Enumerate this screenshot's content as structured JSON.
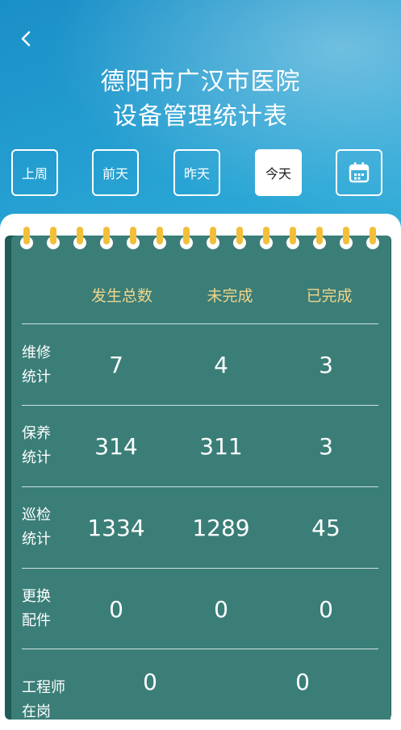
{
  "header": {
    "back_icon": "chevron-left-icon",
    "title_line1": "德阳市广汉市医院",
    "title_line2": "设备管理统计表"
  },
  "date_tabs": [
    {
      "label": "上周",
      "active": false
    },
    {
      "label": "前天",
      "active": false
    },
    {
      "label": "昨天",
      "active": false
    },
    {
      "label": "今天",
      "active": true
    }
  ],
  "calendar_icon": "calendar-icon",
  "colors": {
    "accent_gold": "#f1d58a",
    "card_teal": "#3b7e78",
    "ring_yellow": "#f2bf3b"
  },
  "table": {
    "columns": [
      "发生总数",
      "未完成",
      "已完成"
    ],
    "rows": [
      {
        "label": "维修统计",
        "line1": "维修",
        "line2": "统计",
        "total": "7",
        "incomplete": "4",
        "complete": "3"
      },
      {
        "label": "保养统计",
        "line1": "保养",
        "line2": "统计",
        "total": "314",
        "incomplete": "311",
        "complete": "3"
      },
      {
        "label": "巡检统计",
        "line1": "巡检",
        "line2": "统计",
        "total": "1334",
        "incomplete": "1289",
        "complete": "45"
      },
      {
        "label": "更换配件",
        "line1": "更换",
        "line2": "配件",
        "total": "0",
        "incomplete": "0",
        "complete": "0"
      }
    ],
    "engineer": {
      "line1": "工程师",
      "line2": "在岗",
      "value_a": "0",
      "value_b": "0"
    }
  }
}
